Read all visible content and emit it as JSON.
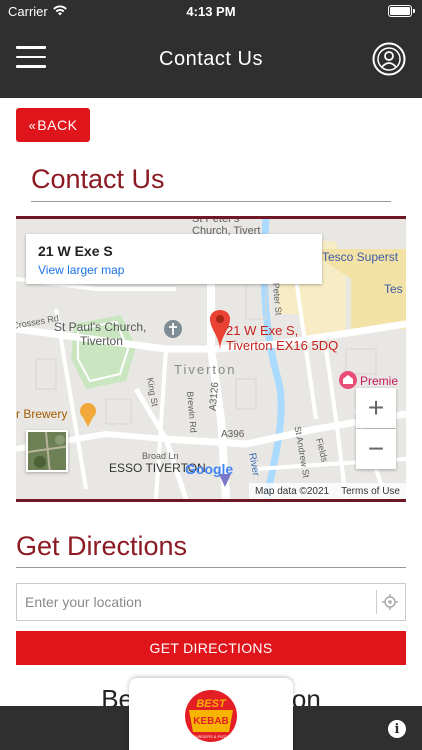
{
  "status_bar": {
    "carrier": "Carrier",
    "time": "4:13 PM"
  },
  "nav": {
    "title": "Contact Us",
    "menu_icon": "hamburger-menu-icon",
    "profile_icon": "user-profile-icon"
  },
  "back_button": {
    "label": "BACK"
  },
  "page_heading": "Contact Us",
  "map": {
    "card_address": "21 W Exe S",
    "card_link": "View larger map",
    "pin_label_line1": "21 W Exe S,",
    "pin_label_line2": "Tiverton EX16 5DQ",
    "labels": {
      "st_pauls": "St Paul's Church,",
      "st_pauls_2": "Tiverton",
      "tiverton": "Tiverton",
      "tesco": "Tesco Superst",
      "tes": "Tes",
      "premier": "Premie",
      "brewery": "r Brewery",
      "esso": "ESSO TIVERTON",
      "a3126": "A3126",
      "a396": "A396",
      "crosses": "Crosses Rd",
      "king_st": "King St",
      "brewin": "Brewin Rd",
      "broad_ln": "Broad Ln",
      "river": "River",
      "st_andrew": "St Andrew St",
      "peter": "St Peter's",
      "church_tiverton": "Church, Tivert",
      "peter_st": "Peter St",
      "fields": "Fields"
    },
    "google": "Google",
    "map_data": "Map data ©2021",
    "terms": "Terms of Use",
    "zoom_in": "+",
    "zoom_out": "−"
  },
  "directions": {
    "heading": "Get Directions",
    "input_placeholder": "Enter your location",
    "button_label": "GET DIRECTIONS"
  },
  "store_name_partial_left": "Bes",
  "store_name_partial_right": "rton",
  "logo": {
    "word1": "BEST",
    "word2": "KEBAB",
    "word3": "BURGERS & PIZZA"
  },
  "colors": {
    "accent": "#e0151b",
    "heading": "#8b1a23",
    "bar": "#2f2f2f"
  }
}
